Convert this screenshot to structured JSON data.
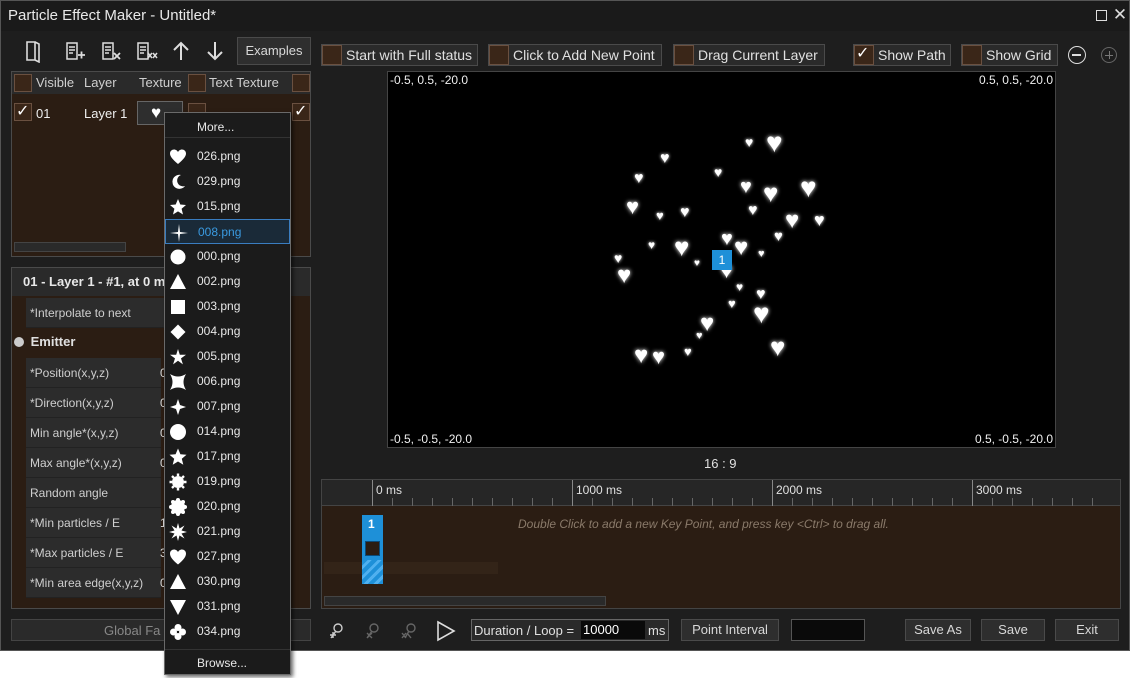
{
  "window": {
    "title": "Particle Effect Maker - Untitled*"
  },
  "toolbar": {
    "examples_label": "Examples"
  },
  "options": {
    "full_status": "Start with Full status",
    "add_point": "Click to Add New Point",
    "drag_layer": "Drag Current Layer",
    "show_path": "Show Path",
    "show_grid": "Show Grid",
    "show_path_checked": true,
    "show_grid_checked": false
  },
  "layers": {
    "columns": [
      "Visible",
      "Layer",
      "Texture",
      "Text Texture"
    ],
    "rows": [
      {
        "index": "01",
        "name": "Layer 1"
      }
    ]
  },
  "properties": {
    "header": "01 - Layer 1 - #1, at 0 m",
    "interpolate_label": "*Interpolate to next",
    "emitter_label": "Emitter",
    "rows": [
      {
        "label": "*Position(x,y,z)",
        "value": "0"
      },
      {
        "label": "*Direction(x,y,z)",
        "value": "0"
      },
      {
        "label": "Min angle*(x,y,z)",
        "value": "0"
      },
      {
        "label": "Max angle*(x,y,z)",
        "value": "0"
      },
      {
        "label": "Random angle",
        "value": ""
      },
      {
        "label": "*Min particles / E",
        "value": "1"
      },
      {
        "label": "*Max particles / E",
        "value": "3"
      },
      {
        "label": "*Min area edge(x,y,z)",
        "value": "0"
      }
    ],
    "global_label": "Global Fa"
  },
  "canvas": {
    "top_left": "-0.5, 0.5, -20.0",
    "top_right": "0.5, 0.5, -20.0",
    "bottom_left": "-0.5, -0.5, -20.0",
    "bottom_right": "0.5, -0.5, -20.0",
    "point_label": "1",
    "aspect": "16 : 9"
  },
  "timeline": {
    "ticks": [
      "0 ms",
      "1000 ms",
      "2000 ms",
      "3000 ms"
    ],
    "hint": "Double Click to add a new Key Point, and press key <Ctrl> to drag all.",
    "key_label": "1"
  },
  "bottom": {
    "duration_label": "Duration / Loop =",
    "duration_value": "10000",
    "duration_unit": "ms",
    "point_interval": "Point Interval",
    "save_as": "Save As",
    "save": "Save",
    "exit": "Exit"
  },
  "texture_menu": {
    "more": "More...",
    "browse": "Browse...",
    "selected": "008.png",
    "items": [
      {
        "name": "026.png",
        "icon": "heart-icon"
      },
      {
        "name": "029.png",
        "icon": "moon-icon"
      },
      {
        "name": "015.png",
        "icon": "star-icon"
      },
      {
        "name": "008.png",
        "icon": "sparkle-icon"
      },
      {
        "name": "000.png",
        "icon": "circle-icon"
      },
      {
        "name": "002.png",
        "icon": "triangle-icon"
      },
      {
        "name": "003.png",
        "icon": "square-icon"
      },
      {
        "name": "004.png",
        "icon": "diamond-icon"
      },
      {
        "name": "005.png",
        "icon": "star-icon"
      },
      {
        "name": "006.png",
        "icon": "concave-square-icon"
      },
      {
        "name": "007.png",
        "icon": "four-point-star-icon"
      },
      {
        "name": "014.png",
        "icon": "circle-icon"
      },
      {
        "name": "017.png",
        "icon": "star-icon"
      },
      {
        "name": "019.png",
        "icon": "gear-icon"
      },
      {
        "name": "020.png",
        "icon": "cloud-circle-icon"
      },
      {
        "name": "021.png",
        "icon": "burst-icon"
      },
      {
        "name": "027.png",
        "icon": "heart-icon"
      },
      {
        "name": "030.png",
        "icon": "triangle-icon"
      },
      {
        "name": "031.png",
        "icon": "down-triangle-icon"
      },
      {
        "name": "034.png",
        "icon": "clover-icon"
      }
    ]
  },
  "colors": {
    "accent": "#1e90d8",
    "panel": "#2b1d13"
  }
}
